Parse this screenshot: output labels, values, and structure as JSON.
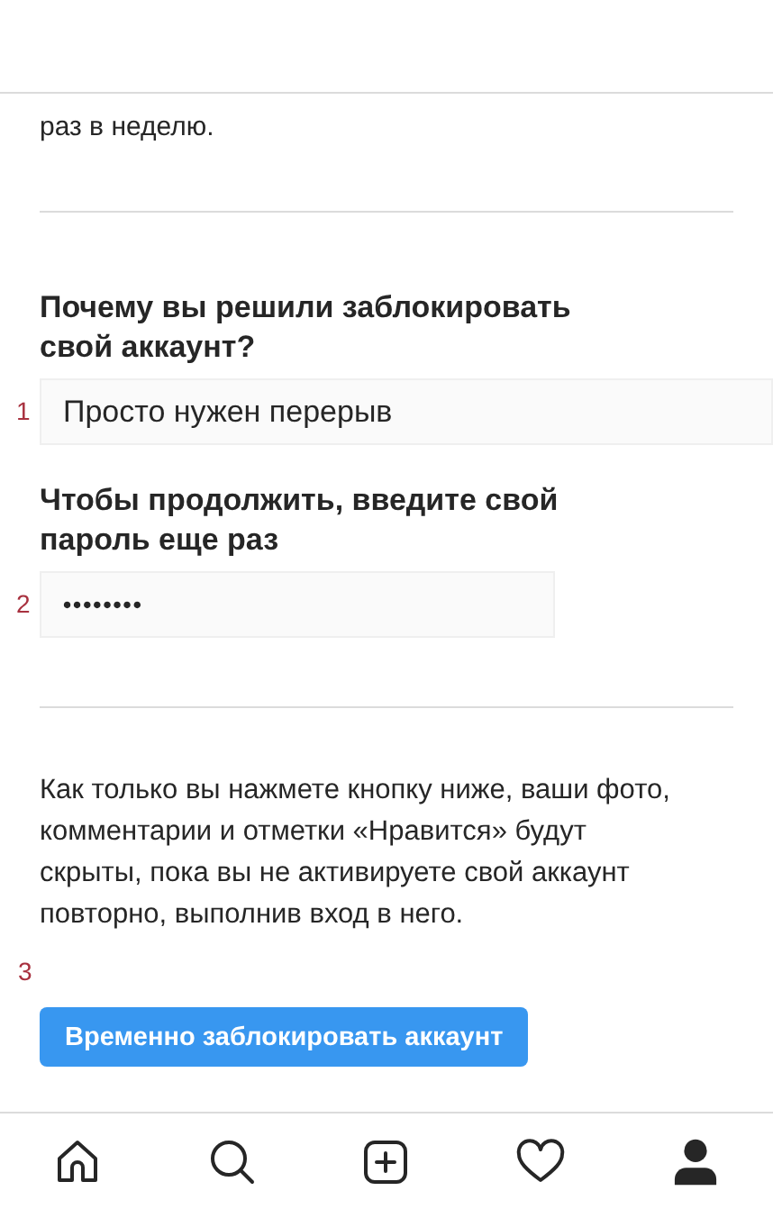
{
  "intro_tail": "раз в неделю.",
  "reason": {
    "marker": "1",
    "label": "Почему вы решили заблокировать свой аккаунт?",
    "value": "Просто нужен перерыв"
  },
  "password": {
    "marker": "2",
    "label": "Чтобы продолжить, введите свой пароль еще раз",
    "value": "••••••••"
  },
  "notice": "Как только вы нажмете кнопку ниже, ваши фото, комментарии и отметки «Нравится» будут скрыты, пока вы не активируете свой аккаунт повторно, выполнив вход в него.",
  "button_marker": "3",
  "button": "Временно заблокировать аккаунт",
  "nav": [
    {
      "kind": "home",
      "selected": false
    },
    {
      "kind": "search",
      "selected": false
    },
    {
      "kind": "add",
      "selected": false
    },
    {
      "kind": "heart",
      "selected": false
    },
    {
      "kind": "profile",
      "selected": true
    }
  ]
}
